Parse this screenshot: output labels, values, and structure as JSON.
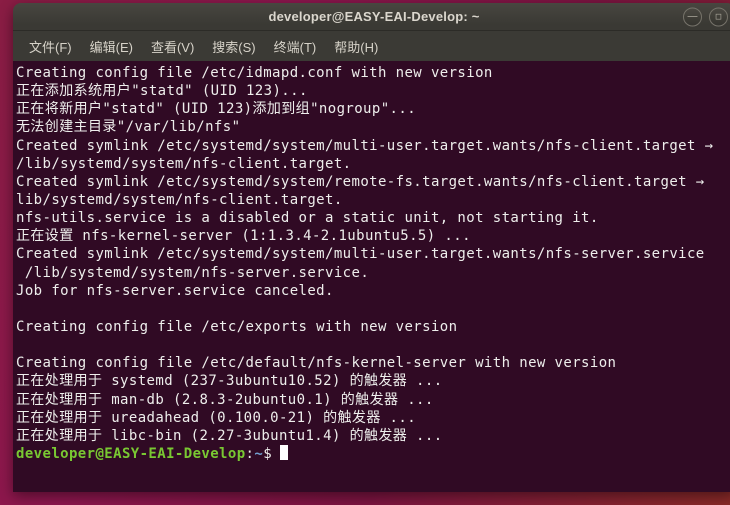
{
  "window": {
    "title": "developer@EASY-EAI-Develop: ~",
    "controls": [
      {
        "name": "minimize",
        "glyph": "—"
      },
      {
        "name": "maximize",
        "glyph": "▫"
      }
    ]
  },
  "menu_items": [
    "文件(F)",
    "编辑(E)",
    "查看(V)",
    "搜索(S)",
    "终端(T)",
    "帮助(H)"
  ],
  "terminal": {
    "output_lines": [
      "Creating config file /etc/idmapd.conf with new version",
      "正在添加系统用户\"statd\" (UID 123)...",
      "正在将新用户\"statd\" (UID 123)添加到组\"nogroup\"...",
      "无法创建主目录\"/var/lib/nfs\"",
      "Created symlink /etc/systemd/system/multi-user.target.wants/nfs-client.target →",
      "/lib/systemd/system/nfs-client.target.",
      "Created symlink /etc/systemd/system/remote-fs.target.wants/nfs-client.target →",
      "lib/systemd/system/nfs-client.target.",
      "nfs-utils.service is a disabled or a static unit, not starting it.",
      "正在设置 nfs-kernel-server (1:1.3.4-2.1ubuntu5.5) ...",
      "Created symlink /etc/systemd/system/multi-user.target.wants/nfs-server.service",
      " /lib/systemd/system/nfs-server.service.",
      "Job for nfs-server.service canceled.",
      "",
      "Creating config file /etc/exports with new version",
      "",
      "Creating config file /etc/default/nfs-kernel-server with new version",
      "正在处理用于 systemd (237-3ubuntu10.52) 的触发器 ...",
      "正在处理用于 man-db (2.8.3-2ubuntu0.1) 的触发器 ...",
      "正在处理用于 ureadahead (0.100.0-21) 的触发器 ...",
      "正在处理用于 libc-bin (2.27-3ubuntu1.4) 的触发器 ..."
    ],
    "prompt": {
      "user_host": "developer@EASY-EAI-Develop",
      "colon": ":",
      "path": "~",
      "dollar": "$"
    }
  },
  "colors": {
    "terminal_bg": "#300a24",
    "prompt_green": "#79c832",
    "path_blue": "#729fcf",
    "titlebar_bg": "#3b3a35",
    "wallpaper_magenta": "#8d164e"
  }
}
